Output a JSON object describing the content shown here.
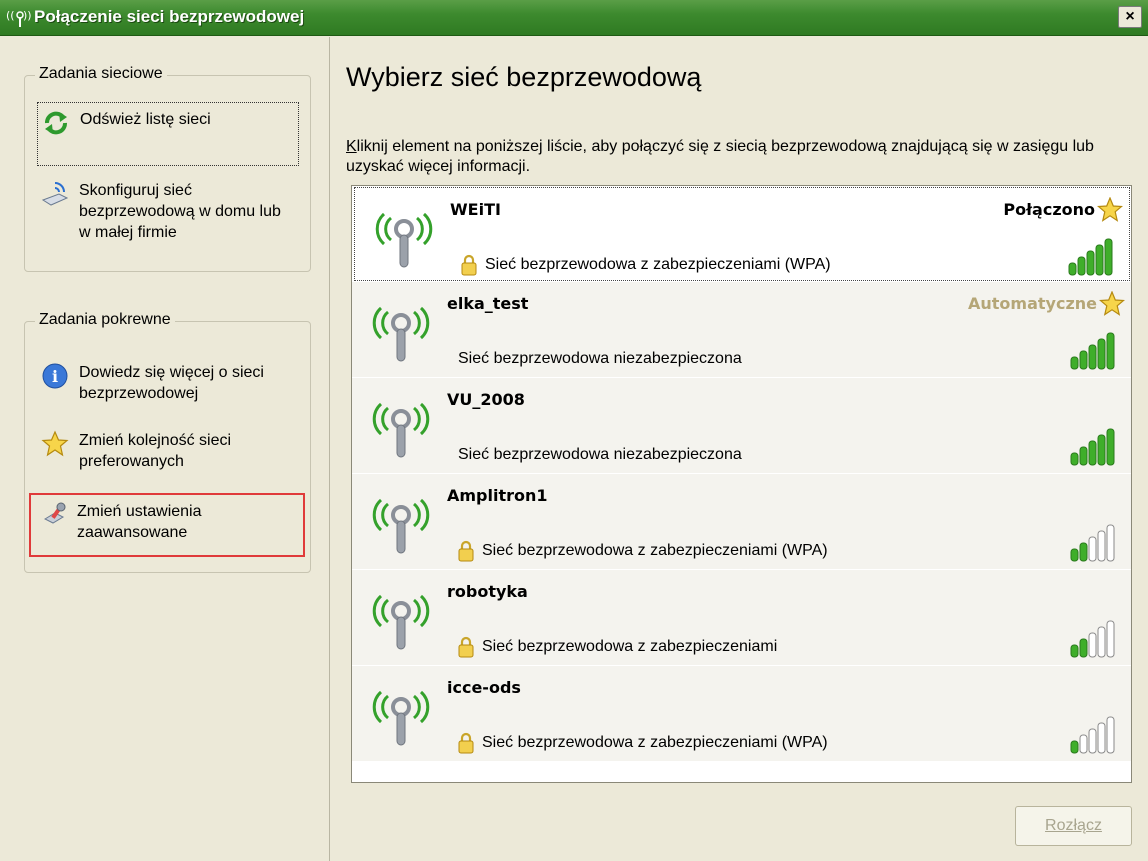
{
  "window": {
    "title": "Połączenie sieci bezprzewodowej",
    "close_label": "×"
  },
  "left": {
    "network_tasks": {
      "title": "Zadania sieciowe",
      "items": [
        {
          "label": "Odśwież listę sieci",
          "icon": "refresh-icon"
        },
        {
          "label": "Skonfiguruj sieć bezprzewodową w domu lub w małej firmie",
          "icon": "wireless-setup-icon"
        }
      ]
    },
    "related_tasks": {
      "title": "Zadania pokrewne",
      "items": [
        {
          "label": "Dowiedz się więcej o sieci bezprzewodowej",
          "icon": "info-icon"
        },
        {
          "label": "Zmień kolejność sieci preferowanych",
          "icon": "star-icon"
        },
        {
          "label": "Zmień ustawienia zaawansowane",
          "icon": "settings-icon"
        }
      ]
    }
  },
  "main": {
    "heading": "Wybierz sieć bezprzewodową",
    "instruction_first": "K",
    "instruction_rest": "liknij element na poniższej liście, aby połączyć się z siecią bezprzewodową znajdującą się w zasięgu lub uzyskać więcej informacji.",
    "networks": [
      {
        "ssid": "WEiTI",
        "status": "Połączono",
        "description": "Sieć bezprzewodowa z zabezpieczeniami (WPA)",
        "secured": true,
        "signal_bars": 5
      },
      {
        "ssid": "elka_test",
        "status": "Automatyczne",
        "description": "Sieć bezprzewodowa niezabezpieczona",
        "secured": false,
        "signal_bars": 5
      },
      {
        "ssid": "VU_2008",
        "status": "",
        "description": "Sieć bezprzewodowa niezabezpieczona",
        "secured": false,
        "signal_bars": 5
      },
      {
        "ssid": "Amplitron1",
        "status": "",
        "description": "Sieć bezprzewodowa z zabezpieczeniami (WPA)",
        "secured": true,
        "signal_bars": 2
      },
      {
        "ssid": "robotyka",
        "status": "",
        "description": "Sieć bezprzewodowa z zabezpieczeniami",
        "secured": true,
        "signal_bars": 2
      },
      {
        "ssid": "icce-ods",
        "status": "",
        "description": "Sieć bezprzewodowa z zabezpieczeniami (WPA)",
        "secured": true,
        "signal_bars": 1
      }
    ],
    "disconnect_label": "Rozłącz"
  },
  "colors": {
    "signal_on": "#3fae2a",
    "signal_off": "#ffffff",
    "titlebar": "#3d8a2e",
    "highlight_border": "#e03a3a"
  }
}
